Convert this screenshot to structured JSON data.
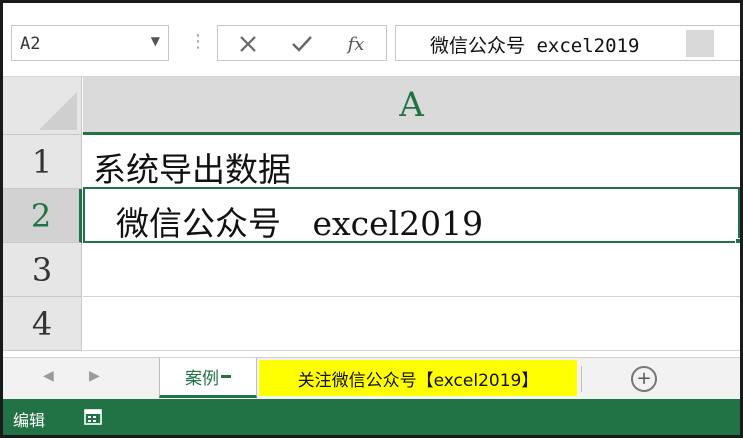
{
  "formula_bar": {
    "name_box": "A2",
    "fx_label": "fx",
    "formula_value": "微信公众号  excel2019"
  },
  "grid": {
    "column_header": "A",
    "rows": [
      {
        "number": "1",
        "value": "系统导出数据"
      },
      {
        "number": "2",
        "value": "  微信公众号   excel2019"
      },
      {
        "number": "3",
        "value": ""
      },
      {
        "number": "4",
        "value": ""
      }
    ]
  },
  "sheet_tabs": [
    {
      "label": "案例"
    },
    {
      "label": "关注微信公众号【excel2019】"
    }
  ],
  "status_bar": {
    "mode": "编辑"
  },
  "colors": {
    "accent": "#217346",
    "tab_highlight": "#ffff00"
  },
  "icons": [
    "chevron-down-icon",
    "cancel-icon",
    "enter-check-icon",
    "function-icon",
    "add-sheet-icon",
    "macro-record-icon"
  ]
}
